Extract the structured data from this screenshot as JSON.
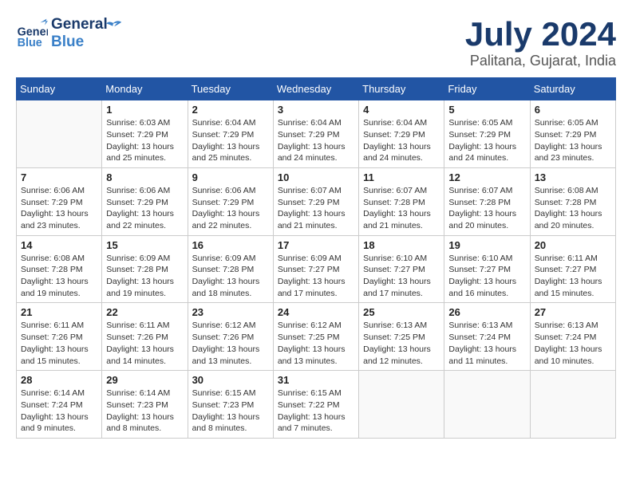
{
  "header": {
    "logo_general": "General",
    "logo_blue": "Blue",
    "month": "July 2024",
    "location": "Palitana, Gujarat, India"
  },
  "weekdays": [
    "Sunday",
    "Monday",
    "Tuesday",
    "Wednesday",
    "Thursday",
    "Friday",
    "Saturday"
  ],
  "weeks": [
    [
      {
        "day": "",
        "info": ""
      },
      {
        "day": "1",
        "info": "Sunrise: 6:03 AM\nSunset: 7:29 PM\nDaylight: 13 hours\nand 25 minutes."
      },
      {
        "day": "2",
        "info": "Sunrise: 6:04 AM\nSunset: 7:29 PM\nDaylight: 13 hours\nand 25 minutes."
      },
      {
        "day": "3",
        "info": "Sunrise: 6:04 AM\nSunset: 7:29 PM\nDaylight: 13 hours\nand 24 minutes."
      },
      {
        "day": "4",
        "info": "Sunrise: 6:04 AM\nSunset: 7:29 PM\nDaylight: 13 hours\nand 24 minutes."
      },
      {
        "day": "5",
        "info": "Sunrise: 6:05 AM\nSunset: 7:29 PM\nDaylight: 13 hours\nand 24 minutes."
      },
      {
        "day": "6",
        "info": "Sunrise: 6:05 AM\nSunset: 7:29 PM\nDaylight: 13 hours\nand 23 minutes."
      }
    ],
    [
      {
        "day": "7",
        "info": "Sunrise: 6:06 AM\nSunset: 7:29 PM\nDaylight: 13 hours\nand 23 minutes."
      },
      {
        "day": "8",
        "info": "Sunrise: 6:06 AM\nSunset: 7:29 PM\nDaylight: 13 hours\nand 22 minutes."
      },
      {
        "day": "9",
        "info": "Sunrise: 6:06 AM\nSunset: 7:29 PM\nDaylight: 13 hours\nand 22 minutes."
      },
      {
        "day": "10",
        "info": "Sunrise: 6:07 AM\nSunset: 7:29 PM\nDaylight: 13 hours\nand 21 minutes."
      },
      {
        "day": "11",
        "info": "Sunrise: 6:07 AM\nSunset: 7:28 PM\nDaylight: 13 hours\nand 21 minutes."
      },
      {
        "day": "12",
        "info": "Sunrise: 6:07 AM\nSunset: 7:28 PM\nDaylight: 13 hours\nand 20 minutes."
      },
      {
        "day": "13",
        "info": "Sunrise: 6:08 AM\nSunset: 7:28 PM\nDaylight: 13 hours\nand 20 minutes."
      }
    ],
    [
      {
        "day": "14",
        "info": "Sunrise: 6:08 AM\nSunset: 7:28 PM\nDaylight: 13 hours\nand 19 minutes."
      },
      {
        "day": "15",
        "info": "Sunrise: 6:09 AM\nSunset: 7:28 PM\nDaylight: 13 hours\nand 19 minutes."
      },
      {
        "day": "16",
        "info": "Sunrise: 6:09 AM\nSunset: 7:28 PM\nDaylight: 13 hours\nand 18 minutes."
      },
      {
        "day": "17",
        "info": "Sunrise: 6:09 AM\nSunset: 7:27 PM\nDaylight: 13 hours\nand 17 minutes."
      },
      {
        "day": "18",
        "info": "Sunrise: 6:10 AM\nSunset: 7:27 PM\nDaylight: 13 hours\nand 17 minutes."
      },
      {
        "day": "19",
        "info": "Sunrise: 6:10 AM\nSunset: 7:27 PM\nDaylight: 13 hours\nand 16 minutes."
      },
      {
        "day": "20",
        "info": "Sunrise: 6:11 AM\nSunset: 7:27 PM\nDaylight: 13 hours\nand 15 minutes."
      }
    ],
    [
      {
        "day": "21",
        "info": "Sunrise: 6:11 AM\nSunset: 7:26 PM\nDaylight: 13 hours\nand 15 minutes."
      },
      {
        "day": "22",
        "info": "Sunrise: 6:11 AM\nSunset: 7:26 PM\nDaylight: 13 hours\nand 14 minutes."
      },
      {
        "day": "23",
        "info": "Sunrise: 6:12 AM\nSunset: 7:26 PM\nDaylight: 13 hours\nand 13 minutes."
      },
      {
        "day": "24",
        "info": "Sunrise: 6:12 AM\nSunset: 7:25 PM\nDaylight: 13 hours\nand 13 minutes."
      },
      {
        "day": "25",
        "info": "Sunrise: 6:13 AM\nSunset: 7:25 PM\nDaylight: 13 hours\nand 12 minutes."
      },
      {
        "day": "26",
        "info": "Sunrise: 6:13 AM\nSunset: 7:24 PM\nDaylight: 13 hours\nand 11 minutes."
      },
      {
        "day": "27",
        "info": "Sunrise: 6:13 AM\nSunset: 7:24 PM\nDaylight: 13 hours\nand 10 minutes."
      }
    ],
    [
      {
        "day": "28",
        "info": "Sunrise: 6:14 AM\nSunset: 7:24 PM\nDaylight: 13 hours\nand 9 minutes."
      },
      {
        "day": "29",
        "info": "Sunrise: 6:14 AM\nSunset: 7:23 PM\nDaylight: 13 hours\nand 8 minutes."
      },
      {
        "day": "30",
        "info": "Sunrise: 6:15 AM\nSunset: 7:23 PM\nDaylight: 13 hours\nand 8 minutes."
      },
      {
        "day": "31",
        "info": "Sunrise: 6:15 AM\nSunset: 7:22 PM\nDaylight: 13 hours\nand 7 minutes."
      },
      {
        "day": "",
        "info": ""
      },
      {
        "day": "",
        "info": ""
      },
      {
        "day": "",
        "info": ""
      }
    ]
  ]
}
